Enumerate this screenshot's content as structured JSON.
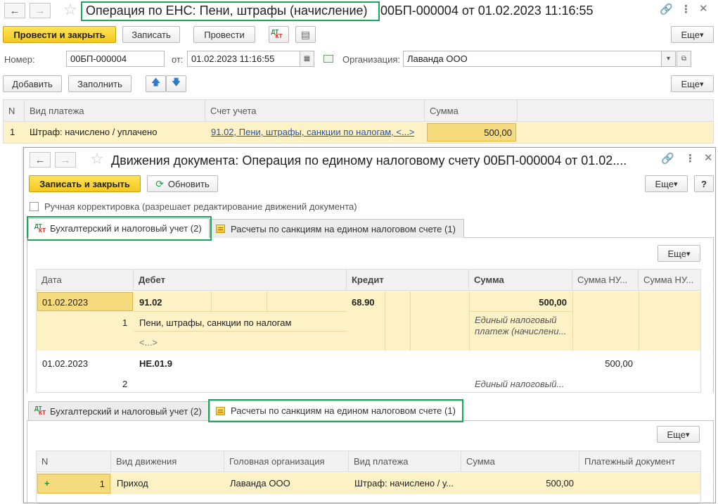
{
  "main": {
    "nav_back": "🡐",
    "nav_fwd": "🡒",
    "title_highlight": "Операция по ЕНС: Пени, штрафы (начисление)",
    "title_rest": "00БП-000004 от 01.02.2023 11:16:55",
    "toolbar": {
      "post_close": "Провести и закрыть",
      "save": "Записать",
      "post": "Провести",
      "more": "Еще"
    },
    "fields": {
      "number_label": "Номер:",
      "number_value": "00БП-000004",
      "date_label": "от:",
      "date_value": "01.02.2023 11:16:55",
      "org_label": "Организация:",
      "org_value": "Лаванда ООО"
    },
    "table_toolbar": {
      "add": "Добавить",
      "fill": "Заполнить",
      "more": "Еще"
    },
    "table": {
      "headers": [
        "N",
        "Вид платежа",
        "Счет учета",
        "Сумма"
      ],
      "row": {
        "n": "1",
        "payment_type": "Штраф: начислено / уплачено",
        "account": "91.02, Пени, штрафы, санкции по налогам, <...>",
        "sum": "500,00"
      }
    }
  },
  "movements": {
    "title": "Движения документа: Операция по единому налоговому счету 00БП-000004 от 01.02....",
    "toolbar": {
      "save_close": "Записать и закрыть",
      "refresh": "Обновить",
      "more": "Еще",
      "help": "?"
    },
    "manual_label": "Ручная корректировка (разрешает редактирование движений документа)",
    "tabs_top": [
      "Бухгалтерский и налоговый учет (2)",
      "Расчеты по санкциям на едином налоговом счете (1)"
    ],
    "accounting_more": "Еще",
    "accounting": {
      "headers": [
        "Дата",
        "Дебет",
        "Кредит",
        "Сумма",
        "Сумма НУ...",
        "Сумма НУ..."
      ],
      "rows": [
        {
          "date": "01.02.2023",
          "n": "1",
          "debit": "91.02",
          "debit_sub1": "Пени, штрафы, санкции по налогам",
          "debit_sub2": "<...>",
          "credit": "68.90",
          "sum": "500,00",
          "content_line1": "Единый налоговый",
          "content_line2": "платеж (начислени..."
        },
        {
          "date": "01.02.2023",
          "n": "2",
          "debit": "НЕ.01.9",
          "sum_nu": "500,00",
          "content": "Единый налоговый..."
        }
      ]
    },
    "tabs_bottom": [
      "Бухгалтерский и налоговый учет (2)",
      "Расчеты по санкциям на едином налоговом счете (1)"
    ],
    "sanctions_more": "Еще",
    "sanctions": {
      "headers": [
        "N",
        "Вид движения",
        "Головная организация",
        "Вид платежа",
        "Сумма",
        "Платежный документ"
      ],
      "row": {
        "plus": "+",
        "n": "1",
        "movement": "Приход",
        "org": "Лаванда ООО",
        "payment_type": "Штраф: начислено / у...",
        "sum": "500,00"
      }
    }
  },
  "colors": {
    "accent_yellow": "#f5c81c",
    "highlight_green": "#1aa85a",
    "row_selected": "#fcf2c5",
    "link": "#2a55a4"
  },
  "icons": {
    "back": "arrow-left-icon",
    "forward": "arrow-right-icon",
    "favorite": "star-icon",
    "link": "link-icon",
    "menu": "kebab-menu-icon",
    "close": "close-icon"
  }
}
